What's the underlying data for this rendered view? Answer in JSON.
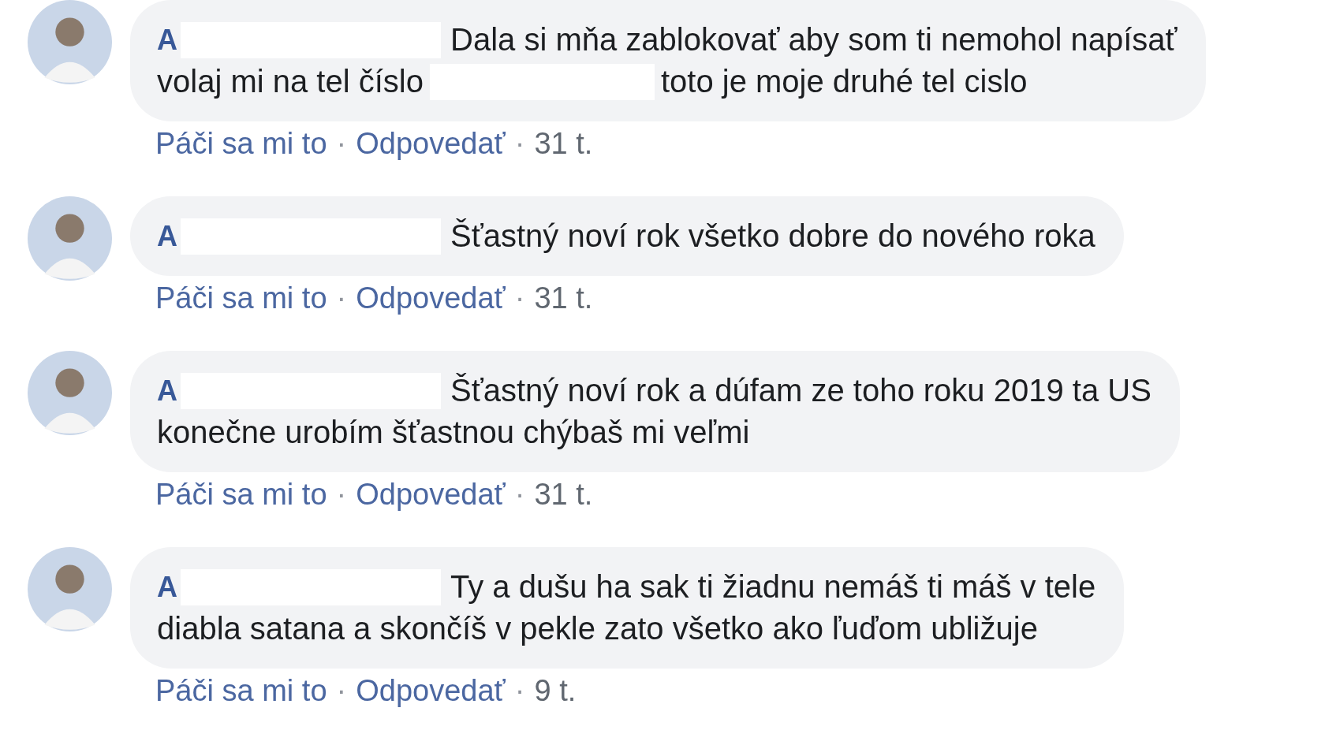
{
  "comments": [
    {
      "author": "A",
      "author_redacted": true,
      "lines": [
        [
          {
            "kind": "text",
            "text": "Dala si mňa zablokovať aby som ti nemohol napísať"
          }
        ],
        [
          {
            "kind": "text",
            "text": "volaj mi na tel číslo"
          },
          {
            "kind": "redacted"
          },
          {
            "kind": "text",
            "text": "toto je moje druhé tel cislo"
          }
        ]
      ],
      "actions": [
        "Páči sa mi to",
        "Odpovedať"
      ],
      "separators": [
        "·",
        "·"
      ],
      "time": "31 t."
    },
    {
      "author": "A",
      "author_redacted": true,
      "lines": [
        [
          {
            "kind": "text",
            "text": "Šťastný noví rok všetko dobre do nového roka"
          }
        ]
      ],
      "actions": [
        "Páči sa mi to",
        "Odpovedať"
      ],
      "separators": [
        "·",
        "·"
      ],
      "time": "31 t."
    },
    {
      "author": "A",
      "author_redacted": true,
      "lines": [
        [
          {
            "kind": "text",
            "text": "Šťastný noví rok a dúfam ze toho roku 2019 ta US"
          }
        ],
        [
          {
            "kind": "text",
            "text": "konečne urobím šťastnou chýbaš mi veľmi"
          }
        ]
      ],
      "actions": [
        "Páči sa mi to",
        "Odpovedať"
      ],
      "separators": [
        "·",
        "·"
      ],
      "time": "31 t."
    },
    {
      "author": "A",
      "author_redacted": true,
      "lines": [
        [
          {
            "kind": "text",
            "text": "Ty a dušu ha sak ti žiadnu nemáš ti máš v tele"
          }
        ],
        [
          {
            "kind": "text",
            "text": "diabla satana a skončíš v pekle zato všetko ako ľuďom ubližuje"
          }
        ]
      ],
      "actions": [
        "Páči sa mi to",
        "Odpovedať"
      ],
      "separators": [
        "·",
        "·"
      ],
      "time": "9 t."
    }
  ]
}
